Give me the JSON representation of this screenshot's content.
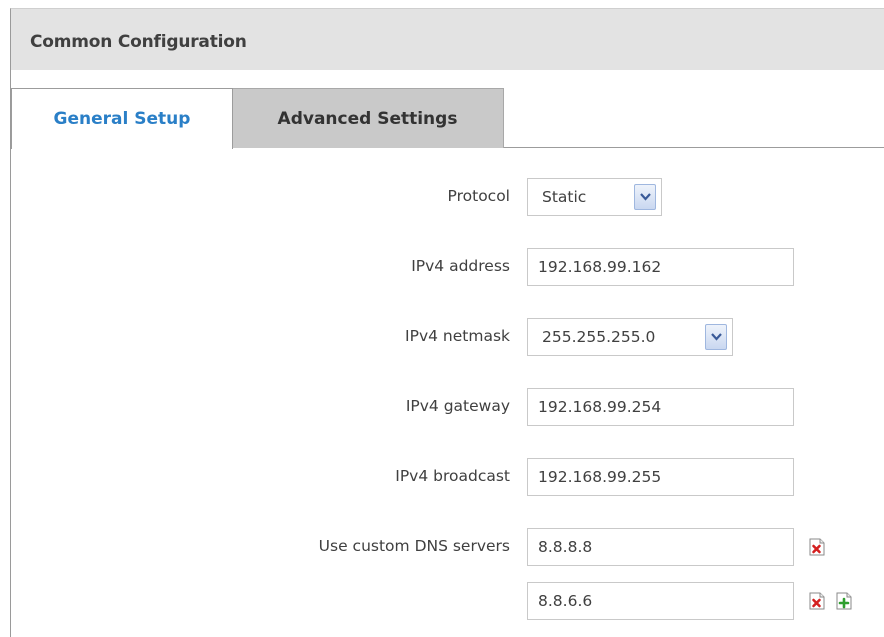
{
  "panel": {
    "title": "Common Configuration"
  },
  "tabs": [
    {
      "label": "General Setup",
      "active": true
    },
    {
      "label": "Advanced Settings",
      "active": false
    }
  ],
  "form": {
    "protocol": {
      "label": "Protocol",
      "value": "Static"
    },
    "ipv4_address": {
      "label": "IPv4 address",
      "value": "192.168.99.162"
    },
    "ipv4_netmask": {
      "label": "IPv4 netmask",
      "value": "255.255.255.0"
    },
    "ipv4_gateway": {
      "label": "IPv4 gateway",
      "value": "192.168.99.254"
    },
    "ipv4_broadcast": {
      "label": "IPv4 broadcast",
      "value": "192.168.99.255"
    },
    "dns": {
      "label": "Use custom DNS servers",
      "servers": [
        "8.8.8.8",
        "8.8.6.6"
      ]
    }
  },
  "icons": {
    "dropdown": "chevron-down-icon",
    "remove": "remove-icon",
    "add": "add-icon"
  },
  "colors": {
    "active_tab_text": "#2a7fc7",
    "header_bg": "#e3e3e3",
    "inactive_tab_bg": "#c9c9c9",
    "remove_icon": "#d42020",
    "add_icon": "#2e9e2e"
  }
}
